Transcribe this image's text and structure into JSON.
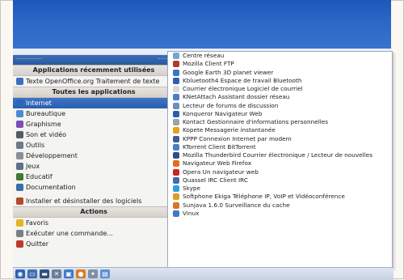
{
  "start_menu": {
    "topbar_left": "·················",
    "topbar_right": "·········",
    "recent_header": "Applications récemment utilisées",
    "recent_items": [
      {
        "label": "Texte OpenOffice.org Traitement de texte",
        "icon": "writer-icon",
        "color": "#3d6fc2"
      }
    ],
    "all_header": "Toutes les applications",
    "categories": [
      {
        "label": "Internet",
        "icon": "internet-icon",
        "color": "#2b66b9",
        "selected": true
      },
      {
        "label": "Bureautique",
        "icon": "office-icon",
        "color": "#4b8bd4"
      },
      {
        "label": "Graphisme",
        "icon": "graphics-icon",
        "color": "#7a4fb5"
      },
      {
        "label": "Son et vidéo",
        "icon": "multimedia-icon",
        "color": "#555a66"
      },
      {
        "label": "Outils",
        "icon": "tools-icon",
        "color": "#6c7a8a"
      },
      {
        "label": "Développement",
        "icon": "development-icon",
        "color": "#8b8f96"
      },
      {
        "label": "Jeux",
        "icon": "games-icon",
        "color": "#5c6f8c"
      },
      {
        "label": "Educatif",
        "icon": "education-icon",
        "color": "#3f7a2f"
      },
      {
        "label": "Documentation",
        "icon": "documentation-icon",
        "color": "#3b6ea8"
      }
    ],
    "install_item": {
      "label": "Installer et désinstaller des logiciels",
      "icon": "install-icon",
      "color": "#b34a2a"
    },
    "actions_header": "Actions",
    "actions": [
      {
        "label": "Favoris",
        "icon": "favorites-icon",
        "color": "#e6b422"
      },
      {
        "label": "Exécuter une commande...",
        "icon": "run-icon",
        "color": "#7a7f88"
      },
      {
        "label": "Quitter",
        "icon": "quit-icon",
        "color": "#c03a2b"
      }
    ]
  },
  "submenu": {
    "items": [
      {
        "label": "Centre réseau",
        "icon": "network-center-icon",
        "color": "#6ea7d8"
      },
      {
        "label": "Mozilla Client FTP",
        "icon": "ftp-icon",
        "color": "#b23a2b"
      },
      {
        "label": "Google Earth 3D planet viewer",
        "icon": "google-earth-icon",
        "color": "#3a76b8"
      },
      {
        "label": "Kbluetooth4 Espace de travail Bluetooth",
        "icon": "bluetooth-icon",
        "color": "#2f5fb3"
      },
      {
        "label": "Courrier électronique Logiciel de courriel",
        "icon": "mail-icon",
        "color": "#d9d9d9"
      },
      {
        "label": "KNetAttach Assistant dossier réseau",
        "icon": "netattach-icon",
        "color": "#4b7fc0"
      },
      {
        "label": "Lecteur de forums de discussion",
        "icon": "news-icon",
        "color": "#6b8fbf"
      },
      {
        "label": "Konqueror Navigateur Web",
        "icon": "konqueror-icon",
        "color": "#2d5ea9"
      },
      {
        "label": "Kontact Gestionnaire d'informations personnelles",
        "icon": "kontact-icon",
        "color": "#9aa2ad"
      },
      {
        "label": "Kopete Messagerie instantanée",
        "icon": "kopete-icon",
        "color": "#e4a21d"
      },
      {
        "label": "KPPP Connexion Internet par modem",
        "icon": "kppp-icon",
        "color": "#3a5f96"
      },
      {
        "label": "KTorrent Client BitTorrent",
        "icon": "ktorrent-icon",
        "color": "#4f7cc1"
      },
      {
        "label": "Mozilla Thunderbird Courrier électronique / Lecteur de nouvelles",
        "icon": "thunderbird-icon",
        "color": "#2e4f8f"
      },
      {
        "label": "Navigateur Web Firefox",
        "icon": "firefox-icon",
        "color": "#e46b1e"
      },
      {
        "label": "Opera Un navigateur web",
        "icon": "opera-icon",
        "color": "#c8261f"
      },
      {
        "label": "Quassel IRC Client IRC",
        "icon": "quassel-icon",
        "color": "#4468b0"
      },
      {
        "label": "Skype",
        "icon": "skype-icon",
        "color": "#2aa0de"
      },
      {
        "label": "Softphone Ekiga Téléphone IP, VoIP et Vidéoconférence",
        "icon": "ekiga-icon",
        "color": "#e29a26"
      },
      {
        "label": "Sunjava 1.6.0 Surveillance du cache",
        "icon": "java-icon",
        "color": "#d6781f"
      },
      {
        "label": "Vinux",
        "icon": "vinux-icon",
        "color": "#3f7bc4"
      }
    ]
  },
  "taskbar": {
    "buttons": [
      {
        "name": "start-menu-button",
        "color": "#2a63b6",
        "glyph": "◉"
      },
      {
        "name": "show-desktop-button",
        "color": "#3c6fb4",
        "glyph": "▭"
      },
      {
        "name": "terminal-button",
        "color": "#2f4f7a",
        "glyph": "▬"
      },
      {
        "name": "tools-button",
        "color": "#6b7e96",
        "glyph": "✕"
      },
      {
        "name": "apps-button",
        "color": "#3b78c8",
        "glyph": "▣"
      },
      {
        "name": "firefox-button",
        "color": "#e07a21",
        "glyph": "●"
      },
      {
        "name": "settings-button",
        "color": "#7f8ea6",
        "glyph": "✦"
      },
      {
        "name": "files-button",
        "color": "#5f8fd0",
        "glyph": "▤"
      }
    ]
  }
}
